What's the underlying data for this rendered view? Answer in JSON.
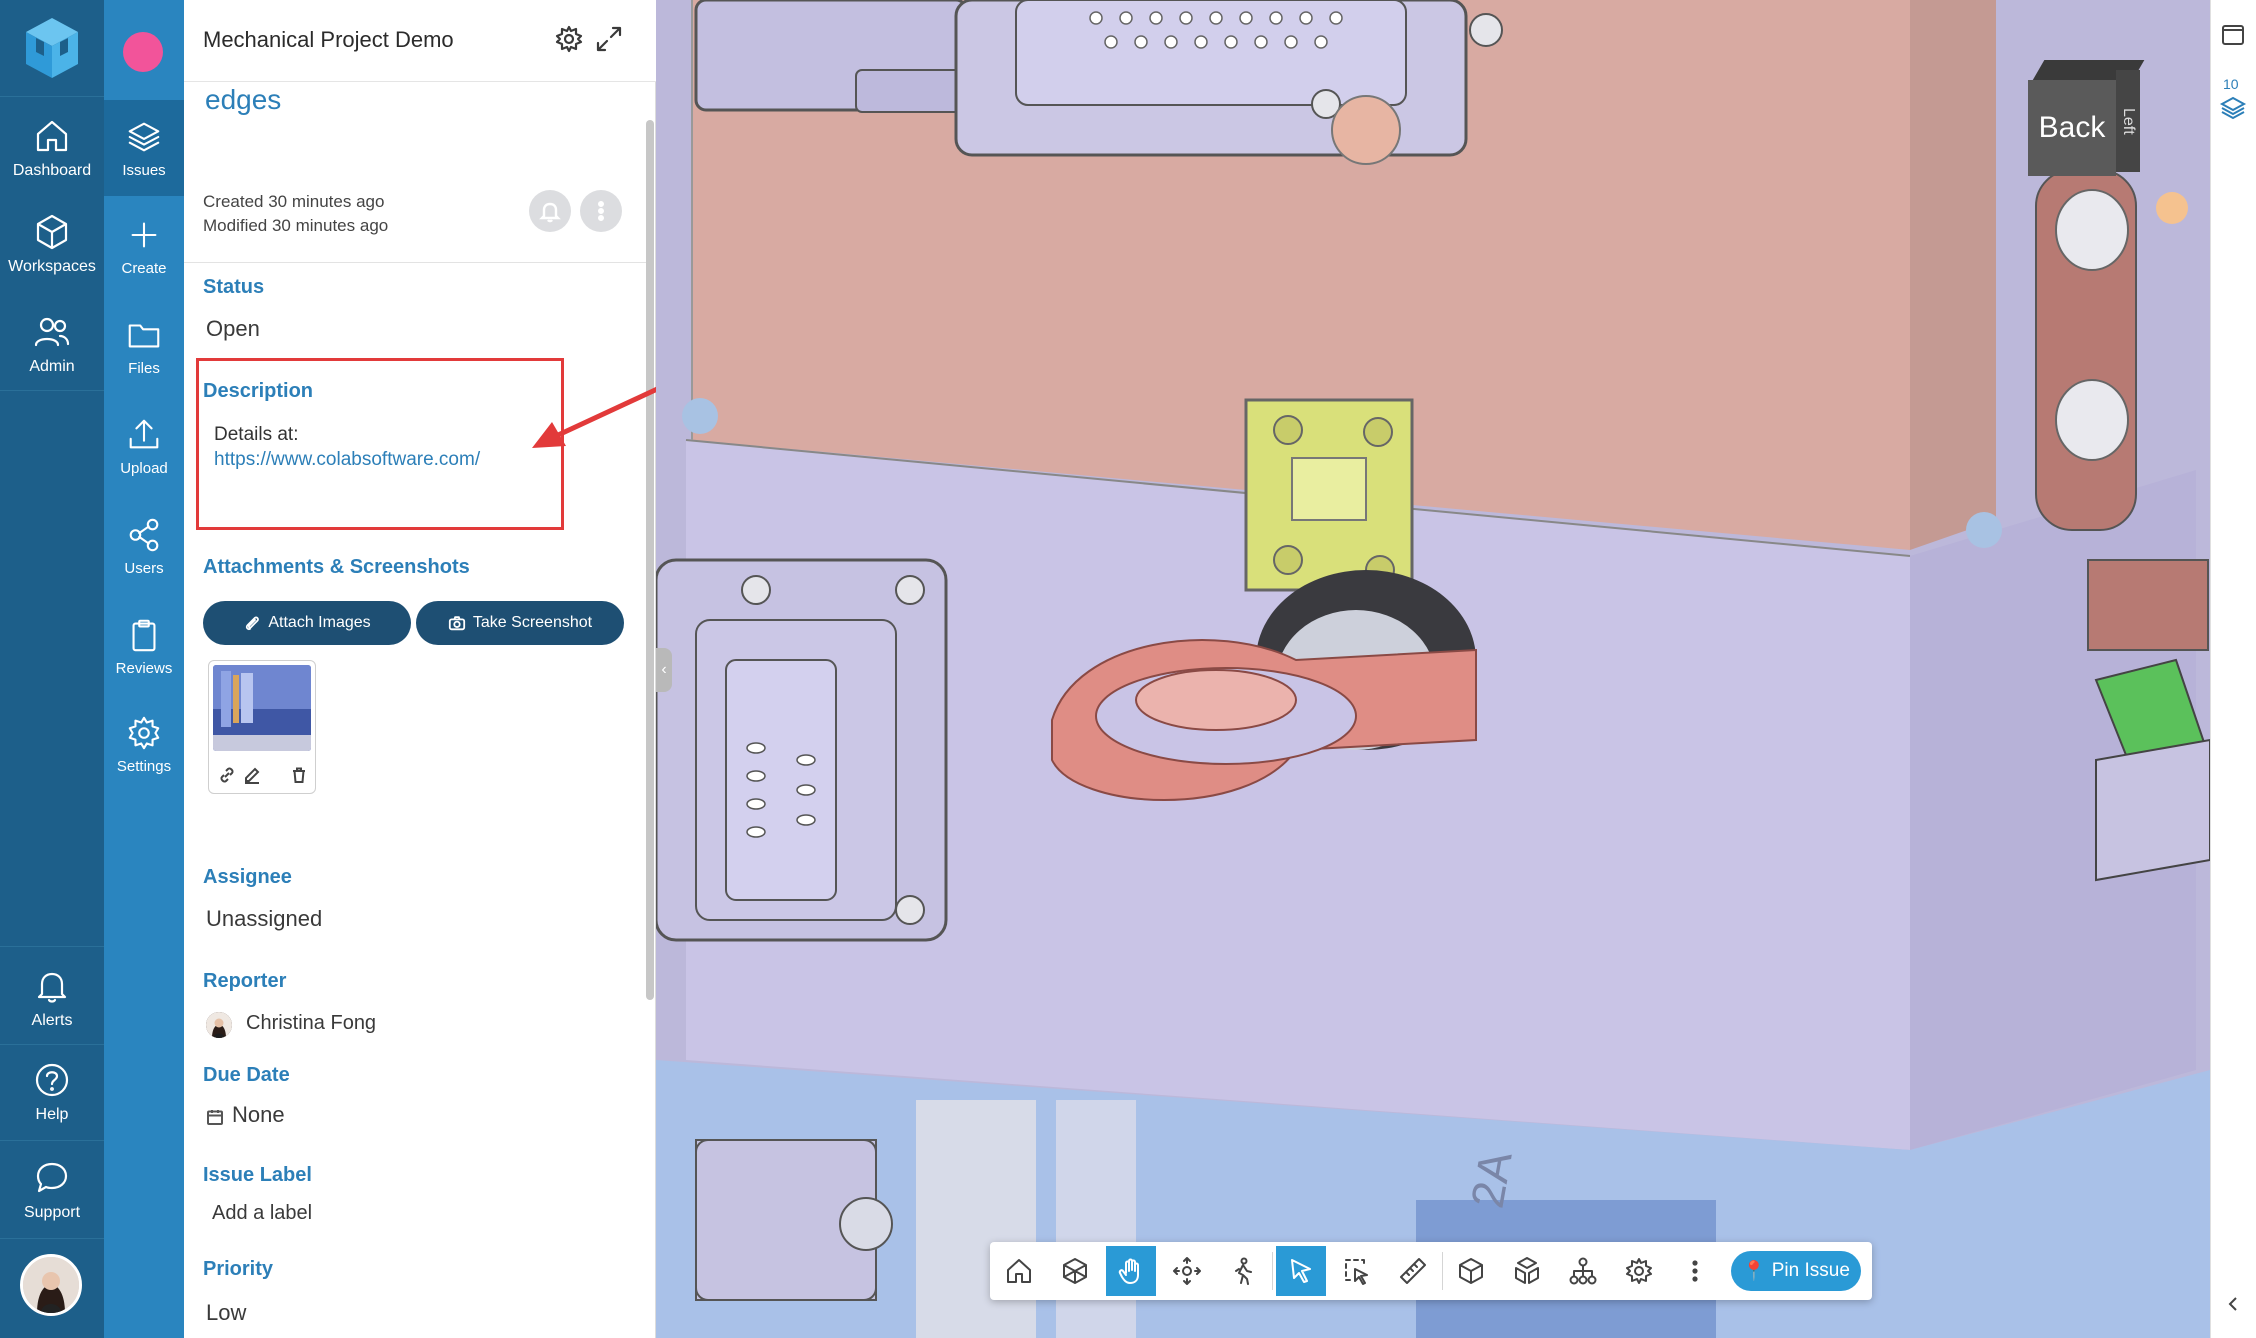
{
  "leftnav": {
    "items": [
      {
        "label": "Dashboard",
        "icon": "home-icon"
      },
      {
        "label": "Workspaces",
        "icon": "cube-icon"
      },
      {
        "label": "Admin",
        "icon": "users-icon"
      },
      {
        "label": "Alerts",
        "icon": "bell-icon"
      },
      {
        "label": "Help",
        "icon": "help-icon"
      },
      {
        "label": "Support",
        "icon": "chat-icon"
      }
    ]
  },
  "subnav": {
    "items": [
      {
        "label": "Issues",
        "icon": "layers-icon"
      },
      {
        "label": "Create",
        "icon": "plus-icon"
      },
      {
        "label": "Files",
        "icon": "folder-icon"
      },
      {
        "label": "Upload",
        "icon": "upload-icon"
      },
      {
        "label": "Users",
        "icon": "share-icon"
      },
      {
        "label": "Reviews",
        "icon": "clipboard-icon"
      },
      {
        "label": "Settings",
        "icon": "gear-icon"
      }
    ]
  },
  "panel": {
    "project_title": "Mechanical Project Demo",
    "issue_title": "edges",
    "created": "Created 30 minutes ago",
    "modified": "Modified 30 minutes ago",
    "status_label": "Status",
    "status_value": "Open",
    "description_label": "Description",
    "description_text": "Details at:",
    "description_link": "https://www.colabsoftware.com/",
    "attachments_label": "Attachments & Screenshots",
    "attach_images": "Attach Images",
    "take_screenshot": "Take Screenshot",
    "assignee_label": "Assignee",
    "assignee_value": "Unassigned",
    "reporter_label": "Reporter",
    "reporter_value": "Christina Fong",
    "due_date_label": "Due Date",
    "due_date_value": "None",
    "issue_label_label": "Issue Label",
    "issue_label_value": "Add a label",
    "priority_label": "Priority",
    "priority_value": "Low"
  },
  "viewport": {
    "navcube_front": "Back",
    "navcube_side": "Left",
    "layers_count": "10",
    "part_label": "2A"
  },
  "toolbar": {
    "pin_issue": "Pin Issue",
    "buttons": [
      "home-icon",
      "cube-wire-icon",
      "pan-hand-icon",
      "orbit-icon",
      "walk-icon",
      "select-pointer-icon",
      "box-select-icon",
      "measure-icon",
      "solid-cube-icon",
      "explode-icon",
      "tree-icon",
      "settings-icon",
      "more-icon"
    ]
  },
  "colors": {
    "nav_dark": "#1d5f8a",
    "nav_mid": "#2a85bf",
    "accent": "#2a9ad6",
    "label_blue": "#2c7fb8",
    "annotation_red": "#e23a3a"
  }
}
